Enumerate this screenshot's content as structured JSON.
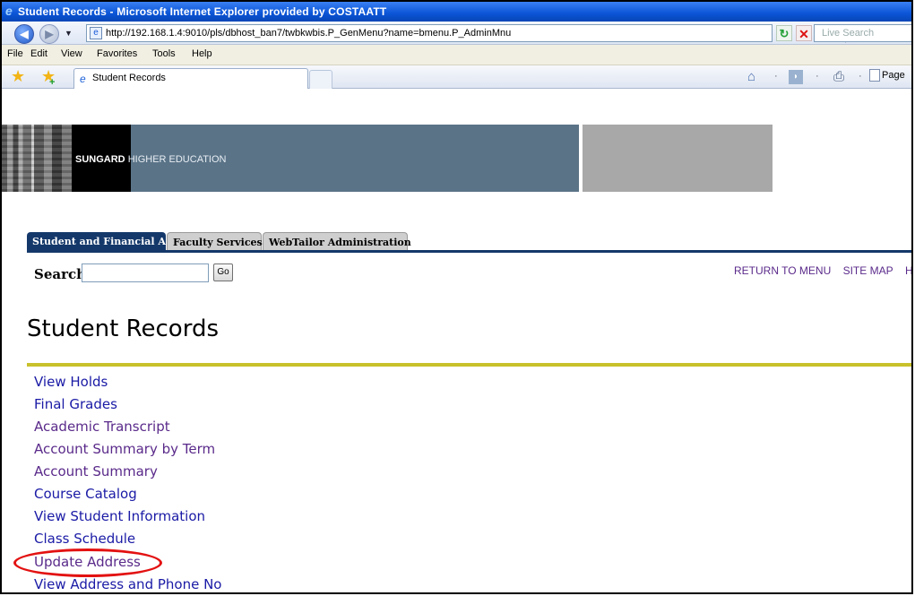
{
  "window": {
    "title": "Student Records - Microsoft Internet Explorer provided by COSTAATT"
  },
  "address_bar": {
    "url": "http://192.168.1.4:9010/pls/dbhost_ban7/twbkwbis.P_GenMenu?name=bmenu.P_AdminMnu",
    "search_placeholder": "Live Search"
  },
  "menu_bar": [
    "File",
    "Edit",
    "View",
    "Favorites",
    "Tools",
    "Help"
  ],
  "browser_tab": {
    "label": "Student Records"
  },
  "toolbar": {
    "page_label": "Page"
  },
  "banner": {
    "brand": "SUNGARD",
    "tagline": "HIGHER EDUCATION"
  },
  "app_tabs": [
    {
      "label": "Student and Financial Aid",
      "active": true
    },
    {
      "label": "Faculty Services",
      "active": false
    },
    {
      "label": "WebTailor Administration",
      "active": false
    }
  ],
  "search": {
    "label": "Search",
    "value": "",
    "go_label": "Go"
  },
  "top_links": [
    "RETURN TO MENU",
    "SITE MAP",
    "H"
  ],
  "page_title": "Student Records",
  "menu_links": [
    {
      "label": "View Holds",
      "color": "#1a1aa6"
    },
    {
      "label": "Final Grades",
      "color": "#1a1aa6"
    },
    {
      "label": "Academic Transcript",
      "color": "#5a2a8a"
    },
    {
      "label": "Account Summary by Term",
      "color": "#5a2a8a"
    },
    {
      "label": "Account Summary",
      "color": "#5a2a8a"
    },
    {
      "label": "Course Catalog",
      "color": "#1a1aa6"
    },
    {
      "label": "View Student Information",
      "color": "#1a1aa6"
    },
    {
      "label": "Class Schedule",
      "color": "#1a1aa6"
    },
    {
      "label": "Update Address",
      "color": "#5a2a8a",
      "highlighted": true
    },
    {
      "label": "View Address and Phone No",
      "color": "#1a1aa6"
    }
  ],
  "colors": {
    "title_bar": "#0a54d6",
    "active_tab": "#14386a",
    "banner_blue": "#5a7387",
    "accent_rule": "#c9c12c",
    "highlight": "#e31111"
  }
}
